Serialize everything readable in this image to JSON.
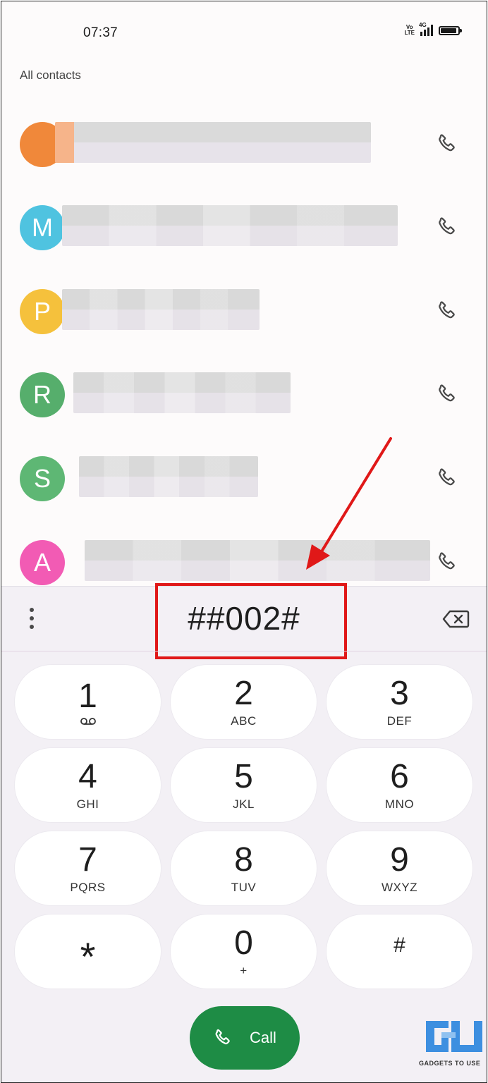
{
  "status_bar": {
    "time": "07:37",
    "volte_top": "Vo",
    "volte_bottom": "LTE",
    "network": "4G",
    "icons": [
      "volte-icon",
      "signal-icon",
      "battery-icon"
    ]
  },
  "contacts_header": "All contacts",
  "contacts": [
    {
      "initial": "",
      "color": "#f0883a"
    },
    {
      "initial": "M",
      "color": "#4fc3e0"
    },
    {
      "initial": "P",
      "color": "#f5c13c"
    },
    {
      "initial": "R",
      "color": "#56ae6c"
    },
    {
      "initial": "S",
      "color": "#5eb774"
    },
    {
      "initial": "A",
      "color": "#f25bb4"
    }
  ],
  "dialer": {
    "number": "##002#",
    "keys": [
      {
        "digit": "1",
        "letters": "",
        "icon": "voicemail-icon"
      },
      {
        "digit": "2",
        "letters": "ABC"
      },
      {
        "digit": "3",
        "letters": "DEF"
      },
      {
        "digit": "4",
        "letters": "GHI"
      },
      {
        "digit": "5",
        "letters": "JKL"
      },
      {
        "digit": "6",
        "letters": "MNO"
      },
      {
        "digit": "7",
        "letters": "PQRS"
      },
      {
        "digit": "8",
        "letters": "TUV"
      },
      {
        "digit": "9",
        "letters": "WXYZ"
      },
      {
        "digit": "*",
        "letters": ""
      },
      {
        "digit": "0",
        "letters": "+"
      },
      {
        "digit": "#",
        "letters": ""
      }
    ],
    "call_label": "Call"
  },
  "annotation": {
    "highlight_color": "#e01818"
  },
  "watermark": {
    "text": "GADGETS TO USE"
  }
}
